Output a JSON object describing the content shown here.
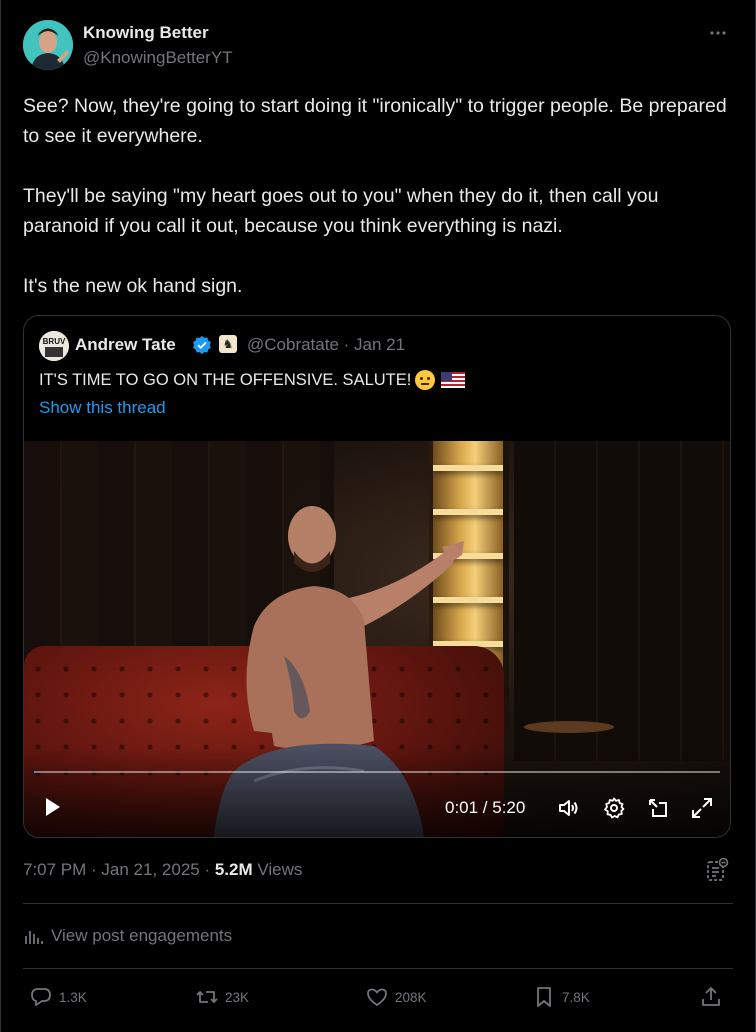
{
  "author": {
    "name": "Knowing Better",
    "handle": "@KnowingBetterYT"
  },
  "more_icon": "more-horizontal-icon",
  "tweet": {
    "paragraphs": [
      "See? Now, they're going to start doing it \"ironically\" to trigger people. Be prepared to see it everywhere.",
      "They'll be saying \"my heart goes out to you\" when they do it, then call you paranoid if you call it out, because you think everything is nazi.",
      "It's the new ok hand sign."
    ]
  },
  "quote": {
    "name": "Andrew Tate",
    "handle_date": "@Cobratate · Jan 21",
    "text": "IT'S TIME TO GO ON THE OFFENSIVE. SALUTE!",
    "show_thread": "Show this thread",
    "avatar_text": "BRUV",
    "video": {
      "time": "0:01 / 5:20",
      "progress": 0.003
    }
  },
  "meta": {
    "timestamp": "7:07 PM · Jan 21, 2025 · ",
    "views_count": "5.2M",
    "views_label": " Views"
  },
  "engagements_label": "View post engagements",
  "actions": {
    "replies": "1.3K",
    "reposts": "23K",
    "likes": "208K",
    "bookmarks": "7.8K"
  },
  "colors": {
    "background": "#000000",
    "text": "#e7e9ea",
    "secondary": "#71767b",
    "accent": "#1d9bf0",
    "border": "#2f3336"
  }
}
